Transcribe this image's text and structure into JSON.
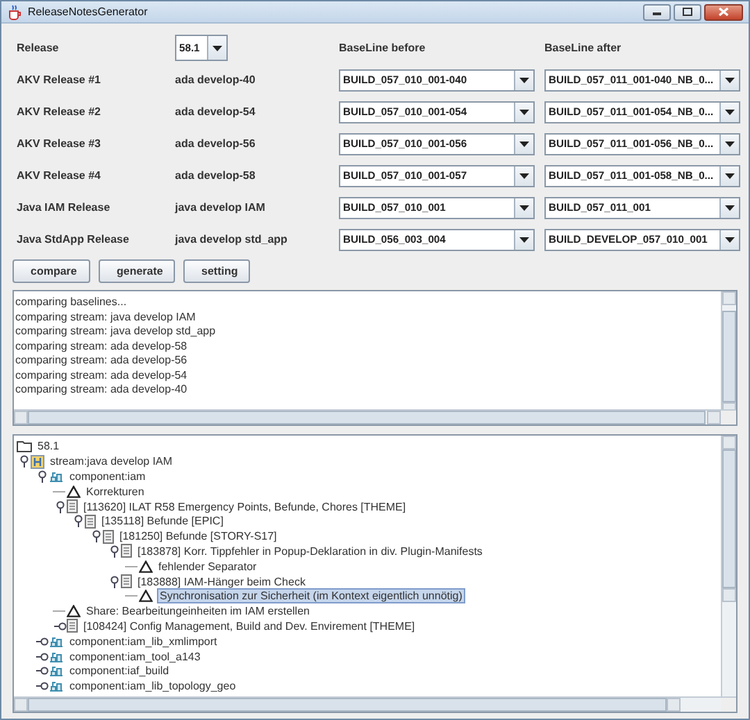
{
  "window": {
    "title": "ReleaseNotesGenerator"
  },
  "release": {
    "label": "Release",
    "value": "58.1"
  },
  "columns": {
    "before": "BaseLine before",
    "after": "BaseLine after"
  },
  "streams": [
    {
      "label": "AKV Release #1",
      "stream": "ada develop-40",
      "before": "BUILD_057_010_001-040",
      "after": "BUILD_057_011_001-040_NB_0..."
    },
    {
      "label": "AKV Release #2",
      "stream": "ada develop-54",
      "before": "BUILD_057_010_001-054",
      "after": "BUILD_057_011_001-054_NB_0..."
    },
    {
      "label": "AKV Release #3",
      "stream": "ada develop-56",
      "before": "BUILD_057_010_001-056",
      "after": "BUILD_057_011_001-056_NB_0..."
    },
    {
      "label": "AKV Release #4",
      "stream": "ada develop-58",
      "before": "BUILD_057_010_001-057",
      "after": "BUILD_057_011_001-058_NB_0..."
    },
    {
      "label": "Java IAM Release",
      "stream": "java develop IAM",
      "before": "BUILD_057_010_001",
      "after": "BUILD_057_011_001"
    },
    {
      "label": "Java StdApp Release",
      "stream": "java develop std_app",
      "before": "BUILD_056_003_004",
      "after": "BUILD_DEVELOP_057_010_001"
    }
  ],
  "buttons": [
    "compare",
    "generate",
    "setting"
  ],
  "log": [
    "comparing baselines...",
    "comparing stream: java develop IAM",
    "comparing stream: java develop std_app",
    "comparing stream: ada develop-58",
    "comparing stream: ada develop-56",
    "comparing stream: ada develop-54",
    "comparing stream: ada develop-40"
  ],
  "tree": {
    "kind": "root",
    "label": "58.1",
    "selected": false,
    "children": [
      {
        "kind": "stream",
        "label": "stream:java develop IAM",
        "expanded": true,
        "selected": false,
        "children": [
          {
            "kind": "component",
            "label": "component:iam",
            "expanded": true,
            "selected": false,
            "children": [
              {
                "kind": "warning",
                "label": "Korrekturen",
                "selected": false
              },
              {
                "kind": "item",
                "label": "[113620] ILAT R58 Emergency Points, Befunde, Chores [THEME]",
                "expanded": true,
                "selected": false,
                "children": [
                  {
                    "kind": "item",
                    "label": "[135118] Befunde [EPIC]",
                    "expanded": true,
                    "selected": false,
                    "children": [
                      {
                        "kind": "item",
                        "label": "[181250] Befunde [STORY-S17]",
                        "expanded": true,
                        "selected": false,
                        "children": [
                          {
                            "kind": "item",
                            "label": "[183878] Korr. Tippfehler in Popup-Deklaration in div. Plugin-Manifests",
                            "expanded": true,
                            "selected": false,
                            "children": [
                              {
                                "kind": "warning",
                                "label": "fehlender Separator",
                                "selected": false
                              }
                            ]
                          },
                          {
                            "kind": "item",
                            "label": "[183888] IAM-Hänger beim Check",
                            "expanded": true,
                            "selected": false,
                            "children": [
                              {
                                "kind": "warning",
                                "label": "Synchronisation zur Sicherheit (im Kontext eigentlich unnötig)",
                                "selected": true
                              }
                            ]
                          }
                        ]
                      }
                    ]
                  }
                ]
              },
              {
                "kind": "warning",
                "label": "Share: Bearbeitungeinheiten im IAM erstellen",
                "selected": false
              },
              {
                "kind": "item",
                "label": "[108424] Config Management, Build and Dev. Envirement [THEME]",
                "expanded": false,
                "selected": false
              }
            ]
          },
          {
            "kind": "component",
            "label": "component:iam_lib_xmlimport",
            "expanded": false,
            "selected": false
          },
          {
            "kind": "component",
            "label": "component:iam_tool_a143",
            "expanded": false,
            "selected": false
          },
          {
            "kind": "component",
            "label": "component:iaf_build",
            "expanded": false,
            "selected": false
          },
          {
            "kind": "component",
            "label": "component:iam_lib_topology_geo",
            "expanded": false,
            "selected": false
          }
        ]
      }
    ]
  }
}
